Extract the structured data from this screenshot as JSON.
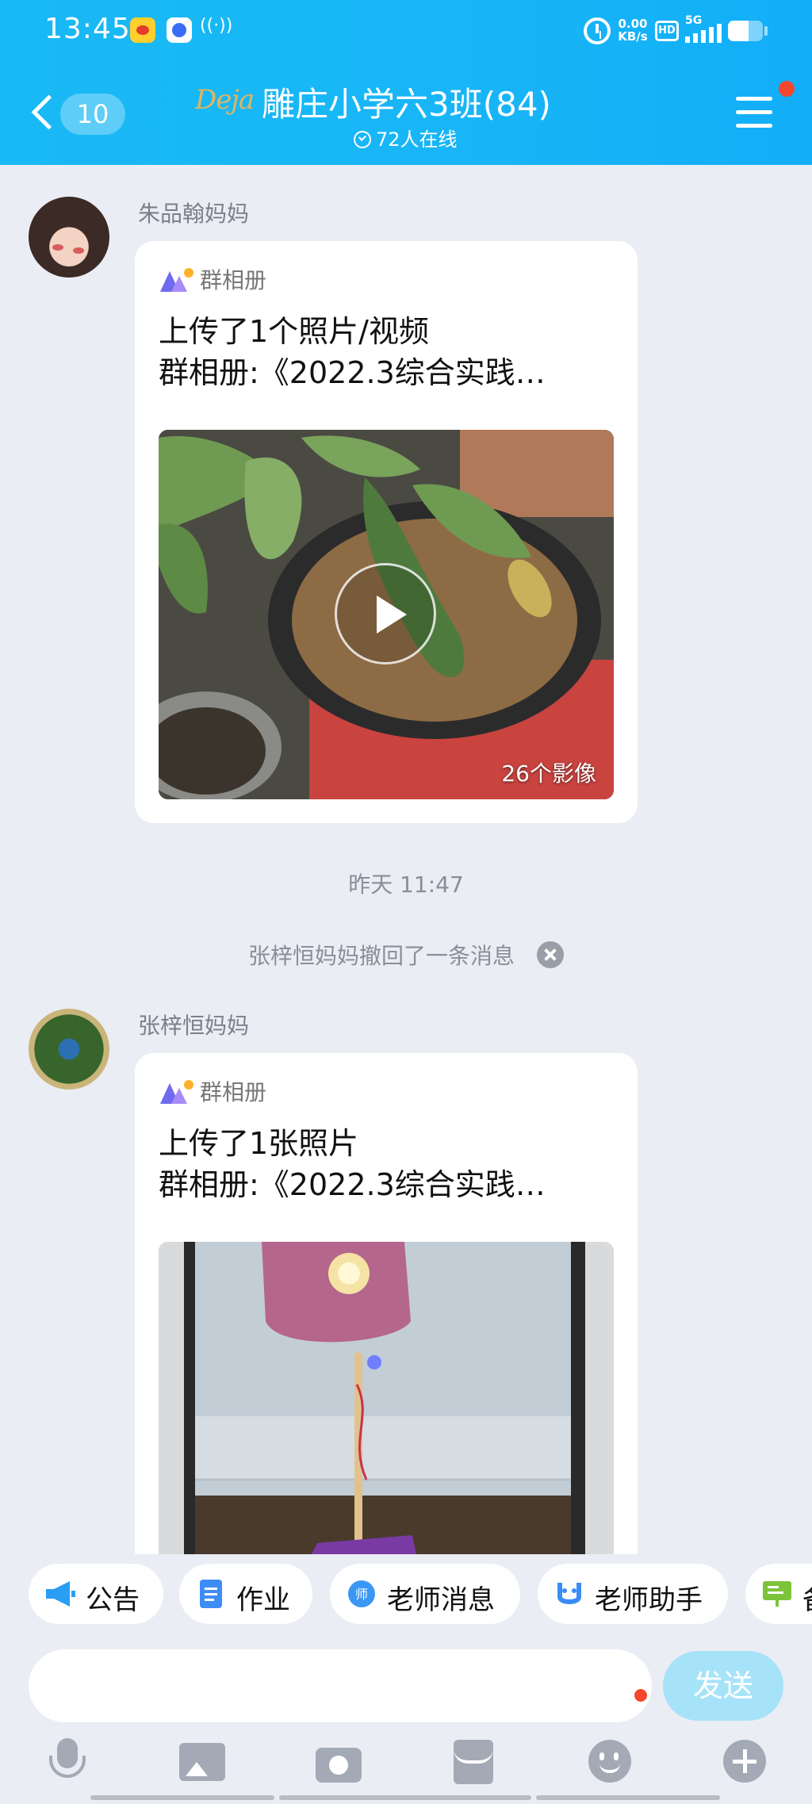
{
  "status_bar": {
    "time": "13:45",
    "net_speed": "0.00",
    "net_unit": "KB/s",
    "hd_label": "HD",
    "signal_label": "5G",
    "icons": [
      "weibo-icon",
      "baidu-icon",
      "nfc-icon",
      "alarm-icon",
      "hd-icon",
      "signal-5g-icon",
      "battery-icon"
    ]
  },
  "header": {
    "back_count": "10",
    "logo_text": "Deja",
    "title": "雕庄小学六3班(84)",
    "online_text": "72人在线",
    "background_color": "#18b6f6",
    "badge_color": "#f4472c"
  },
  "messages": [
    {
      "sender": "朱品翰妈妈",
      "card_label": "群相册",
      "line1": "上传了1个照片/视频",
      "line2": "群相册:《2022.3综合实践…",
      "media_count": "26个影像",
      "media_type": "video"
    },
    {
      "sender": "张梓恒妈妈",
      "card_label": "群相册",
      "line1": "上传了1张照片",
      "line2": "群相册:《2022.3综合实践…",
      "media_type": "photo"
    }
  ],
  "timestamp": "昨天  11:47",
  "recall_notice": "张梓恒妈妈撤回了一条消息",
  "quick_actions": [
    {
      "label": "公告",
      "icon": "megaphone-icon"
    },
    {
      "label": "作业",
      "icon": "document-icon"
    },
    {
      "label": "老师消息",
      "icon": "teacher-message-icon"
    },
    {
      "label": "老师助手",
      "icon": "teacher-assistant-icon"
    },
    {
      "label": "备",
      "icon": "whiteboard-icon"
    }
  ],
  "composer": {
    "input_value": "",
    "send_label": "发送",
    "send_color": "#a6e3f8",
    "tools": [
      "microphone-icon",
      "image-icon",
      "camera-icon",
      "red-packet-icon",
      "emoji-icon",
      "plus-icon"
    ]
  }
}
